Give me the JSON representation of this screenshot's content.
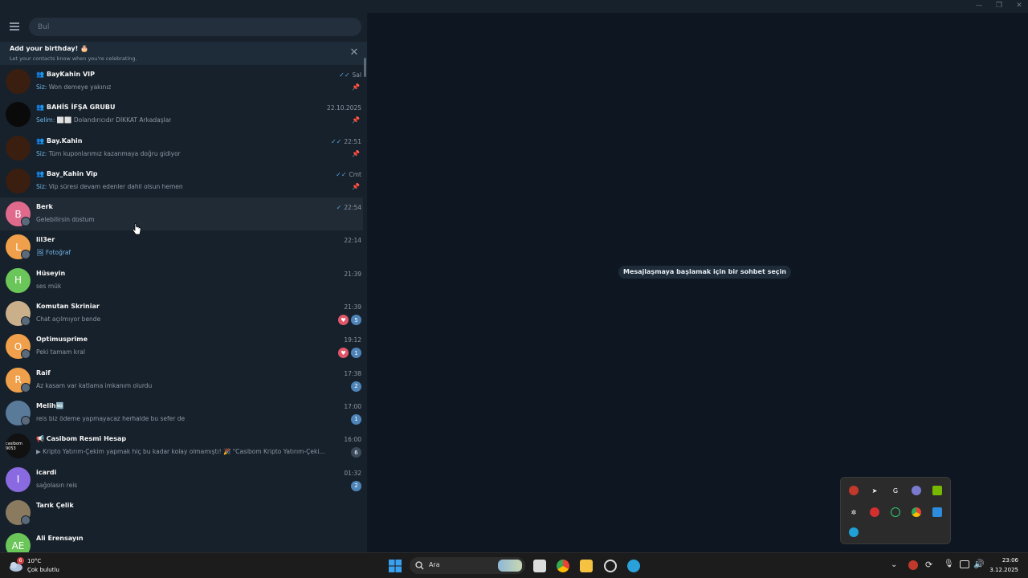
{
  "window": {
    "minimize": "—",
    "restore": "❐",
    "close": "✕"
  },
  "search": {
    "placeholder": "Bul"
  },
  "birthday": {
    "title": "Add your birthday! 🎂",
    "subtitle": "Let your contacts know when you're celebrating."
  },
  "chats": [
    {
      "name": "BayKahin VIP",
      "group": true,
      "time": "Sal",
      "check": "✓✓",
      "sender": "Siz:",
      "message": "Won demeye yakınız",
      "pinned": true,
      "avatar_color": "#3a1e10",
      "avatar_letter": ""
    },
    {
      "name": "BAHİS İFŞA GRUBU",
      "group": true,
      "time": "22.10.2025",
      "check": "",
      "sender": "Selim:",
      "message": "⬜⬜ Dolandırıcıdır DİKKAT Arkadaşlar",
      "pinned": true,
      "avatar_color": "#0a0a0a",
      "avatar_letter": ""
    },
    {
      "name": "Bay.Kahin",
      "group": true,
      "time": "22:51",
      "check": "✓✓",
      "sender": "Siz:",
      "message": "Tüm kuponlarımız kazanmaya doğru gidiyor",
      "pinned": true,
      "avatar_color": "#3a1e10",
      "avatar_letter": ""
    },
    {
      "name": "Bay_Kahin Vip",
      "group": true,
      "time": "Cmt",
      "check": "✓✓",
      "sender": "Siz:",
      "message": "Vip süresi devam edenler dahil olsun hemen",
      "pinned": true,
      "avatar_color": "#3a1e10",
      "avatar_letter": ""
    },
    {
      "name": "Berk",
      "group": false,
      "time": "22:54",
      "check": "✓",
      "sender": "",
      "message": "Gelebilirsin dostum",
      "pinned": false,
      "avatar_color": "#e06a8c",
      "avatar_letter": "B"
    },
    {
      "name": "lil3er",
      "group": false,
      "time": "22:14",
      "check": "",
      "sender": "",
      "message": "🖼 Fotoğraf",
      "pinned": false,
      "avatar_color": "#f0a04b",
      "avatar_letter": "L",
      "blue_msg": true
    },
    {
      "name": "Hüseyin",
      "group": false,
      "time": "21:39",
      "check": "",
      "sender": "",
      "message": "ses mük",
      "pinned": false,
      "avatar_color": "#6bc65a",
      "avatar_letter": "H"
    },
    {
      "name": "Komutan Skriniar",
      "group": false,
      "time": "21:39",
      "check": "",
      "sender": "",
      "message": "Chat açılmıyor bende",
      "pinned": false,
      "avatar_color": "#c9b08a",
      "avatar_letter": "",
      "heart": true,
      "count": "5"
    },
    {
      "name": "Optimusprime",
      "group": false,
      "time": "19:12",
      "check": "",
      "sender": "",
      "message": "Peki tamam kral",
      "pinned": false,
      "avatar_color": "#f0a04b",
      "avatar_letter": "O",
      "heart": true,
      "count": "1"
    },
    {
      "name": "Raif",
      "group": false,
      "time": "17:38",
      "check": "",
      "sender": "",
      "message": "Az kasam var katlama imkanım olurdu",
      "pinned": false,
      "avatar_color": "#f0a04b",
      "avatar_letter": "R",
      "count": "2"
    },
    {
      "name": "Melih🆖",
      "group": false,
      "time": "17:00",
      "check": "",
      "sender": "",
      "message": "reis biz ödeme yapmayacaz herhalde bu sefer de",
      "pinned": false,
      "avatar_color": "#5a7a9a",
      "avatar_letter": "",
      "count": "1"
    },
    {
      "name": "📢 Casibom Resmi Hesap",
      "group": false,
      "time": "16:00",
      "check": "",
      "sender": "",
      "message": "▶ Kripto Yatırım-Çekim yapmak hiç bu kadar kolay olmamıştı! 🎉 \"Casibom Kripto Yatırım-Çeki...",
      "pinned": false,
      "avatar_color": "#111111",
      "avatar_letter": "casibom 9053",
      "count": "6",
      "muted": true
    },
    {
      "name": "icardi",
      "group": false,
      "time": "01:32",
      "check": "",
      "sender": "",
      "message": "sağolasın reis",
      "pinned": false,
      "avatar_color": "#8a6ae0",
      "avatar_letter": "I",
      "count": "2"
    },
    {
      "name": "Tarık Çelik",
      "group": false,
      "time": "",
      "check": "",
      "sender": "",
      "message": "",
      "pinned": false,
      "avatar_color": "#8a7a60",
      "avatar_letter": ""
    },
    {
      "name": "Ali Erensayın",
      "group": false,
      "time": "",
      "check": "",
      "sender": "",
      "message": "",
      "pinned": false,
      "avatar_color": "#6bc65a",
      "avatar_letter": "AE"
    }
  ],
  "main": {
    "empty_state": "Mesajlaşmaya başlamak için bir sohbet seçin"
  },
  "taskbar": {
    "weather_temp": "10°C",
    "weather_desc": "Çok bulutlu",
    "weather_badge": "6",
    "search_label": "Ara",
    "clock_time": "23:06",
    "clock_date": "3.12.2025"
  },
  "colors": {
    "sidebar_bg": "#17212b",
    "main_bg": "#0e1621",
    "accent": "#5ea6e0",
    "unread_badge": "#4e84b8"
  }
}
